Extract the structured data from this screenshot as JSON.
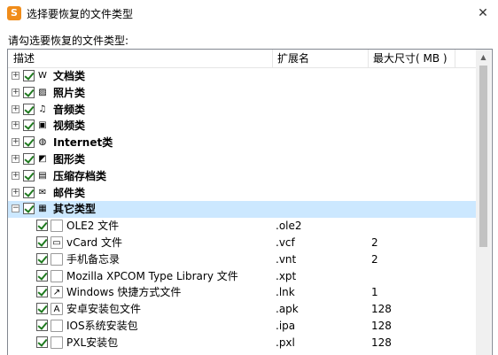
{
  "window": {
    "title": "选择要恢复的文件类型",
    "app_icon": "app-logo-icon",
    "close_glyph": "✕"
  },
  "prompt": "请勾选要恢复的文件类型:",
  "columns": {
    "desc": "描述",
    "ext": "扩展名",
    "size": "最大尺寸( MB )"
  },
  "categories": [
    {
      "label": "文档类",
      "icon": "word-doc-icon",
      "glyph": "W",
      "expanded": false
    },
    {
      "label": "照片类",
      "icon": "photo-icon",
      "glyph": "▨",
      "expanded": false
    },
    {
      "label": "音频类",
      "icon": "music-icon",
      "glyph": "♫",
      "expanded": false
    },
    {
      "label": "视频类",
      "icon": "video-icon",
      "glyph": "▣",
      "expanded": false
    },
    {
      "label": "Internet类",
      "icon": "globe-icon",
      "glyph": "◍",
      "expanded": false
    },
    {
      "label": "图形类",
      "icon": "graphics-icon",
      "glyph": "◩",
      "expanded": false
    },
    {
      "label": "压缩存档类",
      "icon": "archive-icon",
      "glyph": "▤",
      "expanded": false
    },
    {
      "label": "邮件类",
      "icon": "mail-icon",
      "glyph": "✉",
      "expanded": false
    },
    {
      "label": "其它类型",
      "icon": "other-types-icon",
      "glyph": "▦",
      "expanded": true
    }
  ],
  "files": [
    {
      "desc": "OLE2 文件",
      "ext": ".ole2",
      "size": "",
      "icon": "file-icon",
      "glyph": ""
    },
    {
      "desc": "vCard 文件",
      "ext": ".vcf",
      "size": "2",
      "icon": "vcard-icon",
      "glyph": "▭"
    },
    {
      "desc": "手机备忘录",
      "ext": ".vnt",
      "size": "2",
      "icon": "file-icon",
      "glyph": ""
    },
    {
      "desc": "Mozilla XPCOM Type Library 文件",
      "ext": ".xpt",
      "size": "",
      "icon": "file-icon",
      "glyph": ""
    },
    {
      "desc": "Windows 快捷方式文件",
      "ext": ".lnk",
      "size": "1",
      "icon": "shortcut-icon",
      "glyph": "↗"
    },
    {
      "desc": "安卓安装包文件",
      "ext": ".apk",
      "size": "128",
      "icon": "android-icon",
      "glyph": "A"
    },
    {
      "desc": "IOS系统安装包",
      "ext": ".ipa",
      "size": "128",
      "icon": "file-icon",
      "glyph": ""
    },
    {
      "desc": "PXL安装包",
      "ext": ".pxl",
      "size": "128",
      "icon": "file-icon",
      "glyph": ""
    }
  ],
  "colors": {
    "selected_row": "#cce8ff",
    "check": "#1f7a1f",
    "border": "#828790"
  }
}
